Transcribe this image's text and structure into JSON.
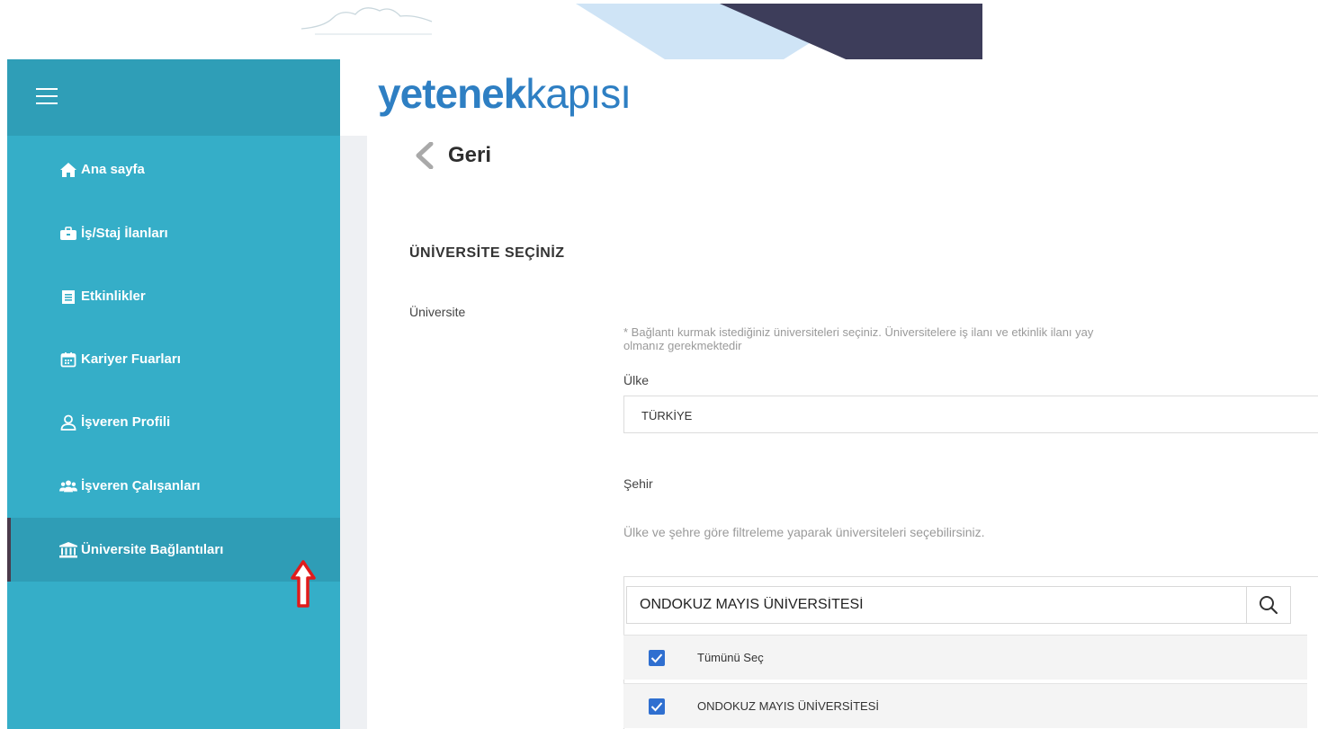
{
  "sidebar": {
    "items": [
      {
        "label": "Ana sayfa",
        "icon": "home-icon"
      },
      {
        "label": "İş/Staj İlanları",
        "icon": "briefcase-icon"
      },
      {
        "label": "Etkinlikler",
        "icon": "notepad-icon"
      },
      {
        "label": "Kariyer Fuarları",
        "icon": "calendar-icon"
      },
      {
        "label": "İşveren Profili",
        "icon": "user-icon"
      },
      {
        "label": "İşveren Çalışanları",
        "icon": "users-icon"
      },
      {
        "label": "Üniversite Bağlantıları",
        "icon": "university-icon",
        "active": true
      }
    ]
  },
  "logo": {
    "part1": "yetenek",
    "part2": "kapısı"
  },
  "header": {
    "back_label": "Geri"
  },
  "main": {
    "section_title": "ÜNİVERSİTE SEÇİNİZ",
    "university_label": "Üniversite",
    "hint_line1": "* Bağlantı kurmak istediğiniz üniversiteleri seçiniz. Üniversitelere iş ilanı ve etkinlik ilanı yay",
    "hint_line2": "olmanız gerekmektedir",
    "country_label": "Ülke",
    "country_value": "TÜRKİYE",
    "city_label": "Şehir",
    "filter_hint": "Ülke ve şehre göre filtreleme yaparak üniversiteleri seçebilirsiniz.",
    "search_value": "ONDOKUZ MAYIS ÜNİVERSİTESİ",
    "options": [
      {
        "label": "Tümünü Seç",
        "checked": true
      },
      {
        "label": "ONDOKUZ MAYIS ÜNİVERSİTESİ",
        "checked": true
      }
    ]
  },
  "colors": {
    "sidebar": "#35aec8",
    "sidebar_header": "#2f9eb7",
    "logo": "#2e7fc3",
    "checkbox": "#2f6fd0",
    "annotation_arrow": "#e11b1b"
  }
}
